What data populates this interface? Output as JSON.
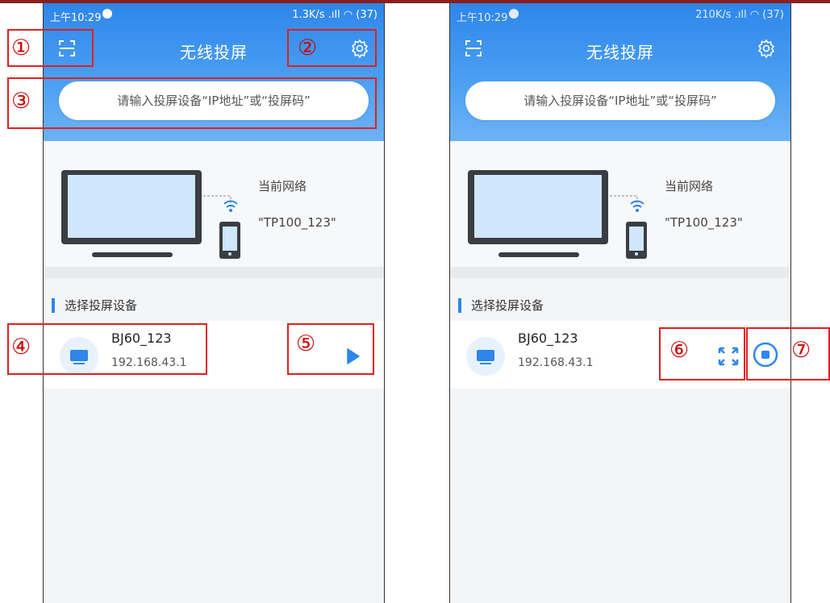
{
  "status": {
    "left_time": "上午10:29",
    "left_net": "1.3K/s",
    "left_battery": "37",
    "right_time": "上午10:29",
    "right_net": "210K/s",
    "right_battery": "37"
  },
  "header": {
    "title": "无线投屏"
  },
  "search": {
    "placeholder": "请输入投屏设备“IP地址”或“投屏码”"
  },
  "network": {
    "label": "当前网络",
    "name": "\"TP100_123\""
  },
  "section": {
    "title": "选择投屏设备"
  },
  "device": {
    "name": "BJ60_123",
    "ip": "192.168.43.1"
  },
  "annotations": {
    "n1": "①",
    "n2": "②",
    "n3": "③",
    "n4": "④",
    "n5": "⑤",
    "n6": "⑥",
    "n7": "⑦"
  },
  "colors": {
    "accent": "#2e86ea",
    "annotation": "#e02020",
    "top_strip": "#8a1f1f"
  },
  "icons": [
    "scan-icon",
    "gear-icon",
    "tv-icon",
    "wifi-icon",
    "phone-icon",
    "monitor-icon",
    "play-icon",
    "expand-icon",
    "stop-icon"
  ]
}
